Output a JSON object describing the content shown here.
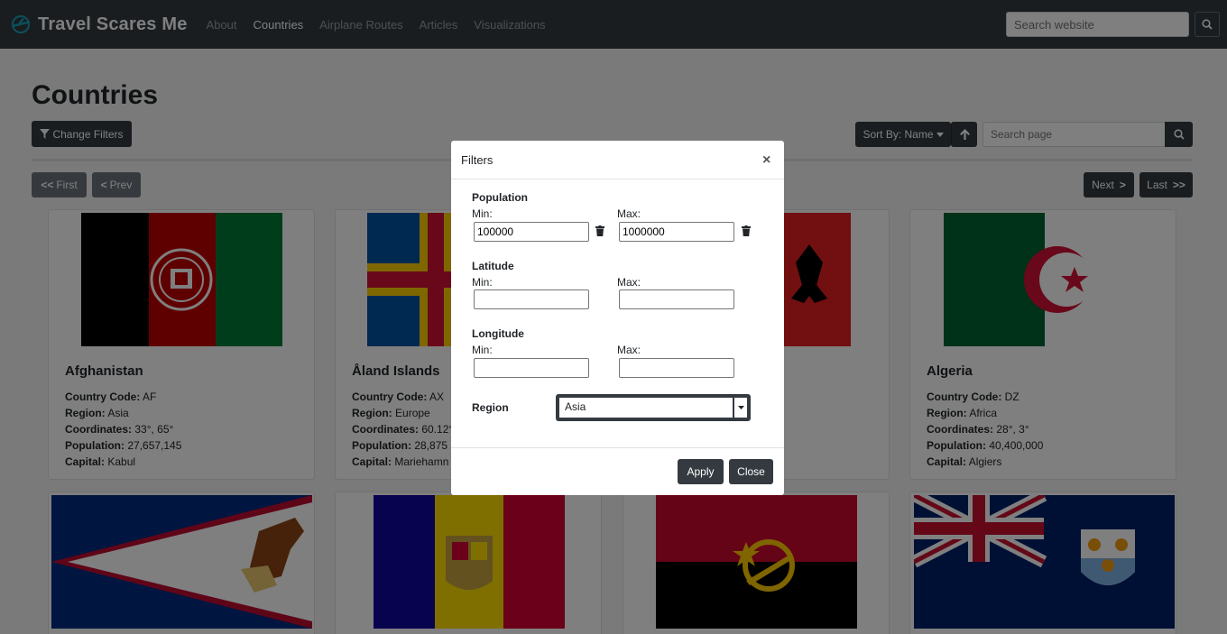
{
  "nav": {
    "brand": "Travel Scares Me",
    "links": [
      "About",
      "Countries",
      "Airplane Routes",
      "Articles",
      "Visualizations"
    ],
    "search_placeholder": "Search website"
  },
  "page": {
    "title": "Countries",
    "change_filters_label": "Change Filters",
    "sort_label": "Sort By: Name",
    "search_placeholder": "Search page",
    "pagination": {
      "first": "First",
      "prev": "Prev",
      "next": "Next",
      "last": "Last"
    }
  },
  "field_labels": {
    "code": "Country Code:",
    "region": "Region:",
    "coords": "Coordinates:",
    "population": "Population:",
    "capital": "Capital:"
  },
  "countries": [
    {
      "name": "Afghanistan",
      "code": "AF",
      "region": "Asia",
      "coords": "33°, 65°",
      "population": "27,657,145",
      "capital": "Kabul"
    },
    {
      "name": "Åland Islands",
      "code": "AX",
      "region": "Europe",
      "coords": "60.12°",
      "population": "28,875",
      "capital": "Mariehamn"
    },
    {
      "name": "",
      "code": "",
      "region": "",
      "coords": "",
      "population": "",
      "capital": ""
    },
    {
      "name": "Algeria",
      "code": "DZ",
      "region": "Africa",
      "coords": "28°, 3°",
      "population": "40,400,000",
      "capital": "Algiers"
    }
  ],
  "modal": {
    "title": "Filters",
    "close_symbol": "×",
    "population_label": "Population",
    "latitude_label": "Latitude",
    "longitude_label": "Longitude",
    "min_label": "Min:",
    "max_label": "Max:",
    "population_min": "100000",
    "population_max": "1000000",
    "latitude_min": "",
    "latitude_max": "",
    "longitude_min": "",
    "longitude_max": "",
    "region_label": "Region",
    "region_value": "Asia",
    "apply_label": "Apply",
    "close_label": "Close"
  }
}
